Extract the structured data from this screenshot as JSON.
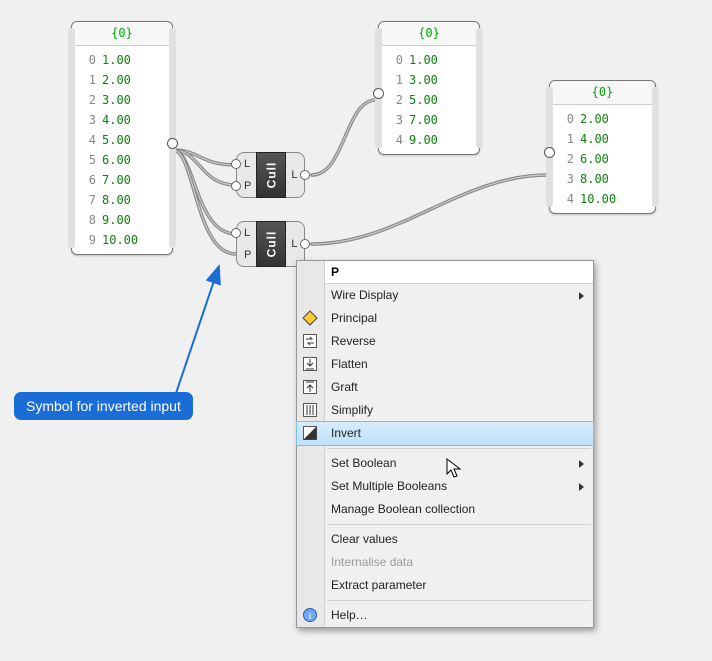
{
  "panels": {
    "p1": {
      "branch": "{0}",
      "rows": [
        {
          "i": "0",
          "v": "1.00"
        },
        {
          "i": "1",
          "v": "2.00"
        },
        {
          "i": "2",
          "v": "3.00"
        },
        {
          "i": "3",
          "v": "4.00"
        },
        {
          "i": "4",
          "v": "5.00"
        },
        {
          "i": "5",
          "v": "6.00"
        },
        {
          "i": "6",
          "v": "7.00"
        },
        {
          "i": "7",
          "v": "8.00"
        },
        {
          "i": "8",
          "v": "9.00"
        },
        {
          "i": "9",
          "v": "10.00"
        }
      ]
    },
    "p2": {
      "branch": "{0}",
      "rows": [
        {
          "i": "0",
          "v": "1.00"
        },
        {
          "i": "1",
          "v": "3.00"
        },
        {
          "i": "2",
          "v": "5.00"
        },
        {
          "i": "3",
          "v": "7.00"
        },
        {
          "i": "4",
          "v": "9.00"
        }
      ]
    },
    "p3": {
      "branch": "{0}",
      "rows": [
        {
          "i": "0",
          "v": "2.00"
        },
        {
          "i": "1",
          "v": "4.00"
        },
        {
          "i": "2",
          "v": "6.00"
        },
        {
          "i": "3",
          "v": "8.00"
        },
        {
          "i": "4",
          "v": "10.00"
        }
      ]
    }
  },
  "components": {
    "cullA": {
      "name": "Cull",
      "in": [
        "L",
        "P"
      ],
      "out": [
        "L"
      ]
    },
    "cullB": {
      "name": "Cull",
      "in": [
        "L",
        "P"
      ],
      "out": [
        "L"
      ]
    }
  },
  "callout": {
    "text": "Symbol for inverted input"
  },
  "menu": {
    "title": "P",
    "items": [
      {
        "type": "item",
        "label": "Wire Display",
        "sub": true,
        "icon": null,
        "name": "menu-wire-display"
      },
      {
        "type": "item",
        "label": "Principal",
        "icon": "principal",
        "name": "menu-principal"
      },
      {
        "type": "item",
        "label": "Reverse",
        "icon": "reverse",
        "name": "menu-reverse"
      },
      {
        "type": "item",
        "label": "Flatten",
        "icon": "flatten",
        "name": "menu-flatten"
      },
      {
        "type": "item",
        "label": "Graft",
        "icon": "graft",
        "name": "menu-graft"
      },
      {
        "type": "item",
        "label": "Simplify",
        "icon": "simplify",
        "name": "menu-simplify"
      },
      {
        "type": "item",
        "label": "Invert",
        "icon": "invert",
        "name": "menu-invert",
        "highlight": true
      },
      {
        "type": "sep"
      },
      {
        "type": "item",
        "label": "Set Boolean",
        "sub": true,
        "name": "menu-set-boolean"
      },
      {
        "type": "item",
        "label": "Set Multiple Booleans",
        "sub": true,
        "name": "menu-set-multiple-booleans"
      },
      {
        "type": "item",
        "label": "Manage Boolean collection",
        "name": "menu-manage-boolean-collection"
      },
      {
        "type": "sep"
      },
      {
        "type": "item",
        "label": "Clear values",
        "name": "menu-clear-values"
      },
      {
        "type": "item",
        "label": "Internalise data",
        "name": "menu-internalise-data",
        "disabled": true
      },
      {
        "type": "item",
        "label": "Extract parameter",
        "name": "menu-extract-parameter"
      },
      {
        "type": "sep"
      },
      {
        "type": "item",
        "label": "Help…",
        "icon": "help",
        "name": "menu-help"
      }
    ]
  },
  "icons": {
    "principal": "<svg viewBox='0 0 16 16'><polygon points='8,1 15,8 8,15 1,8' fill='#ffcc33' stroke='#444'/></svg>",
    "reverse": "<svg viewBox='0 0 16 16'><rect x='1.5' y='1.5' width='13' height='13' fill='#fff' stroke='#555'/><path d='M4,6 h6 l-2,-2 M12,10 h-6 l2,2' stroke='#333' fill='none'/></svg>",
    "flatten": "<svg viewBox='0 0 16 16'><rect x='1.5' y='1.5' width='13' height='13' fill='#fff' stroke='#555'/><path d='M8,3 v7 m-3,-3 l3,3 l3,-3 M4,13 h8' stroke='#333' fill='none'/></svg>",
    "graft": "<svg viewBox='0 0 16 16'><rect x='1.5' y='1.5' width='13' height='13' fill='#fff' stroke='#555'/><path d='M8,13 v-7 m-3,3 l3,-3 l3,3 M4,3 h8' stroke='#333' fill='none'/></svg>",
    "simplify": "<svg viewBox='0 0 16 16'><rect x='1.5' y='1.5' width='13' height='13' fill='#fff' stroke='#555'/><path d='M5,3 v10 M8,3 v10 M11,3 v10' stroke='#333'/></svg>",
    "invert": "<svg viewBox='0 0 16 16'><rect x='1.5' y='1.5' width='13' height='13' fill='#fff' stroke='#555'/><path d='M1.5,14.5 L14.5,1.5 L14.5,14.5 Z' fill='#333'/></svg>",
    "help": "<svg viewBox='0 0 16 16'><circle cx='8' cy='8' r='6.5' fill='#6fa8ff' stroke='#2a5db0'/><text x='8' y='12' text-anchor='middle' font-size='10' fill='#fff' font-family='Georgia'>i</text></svg>"
  }
}
